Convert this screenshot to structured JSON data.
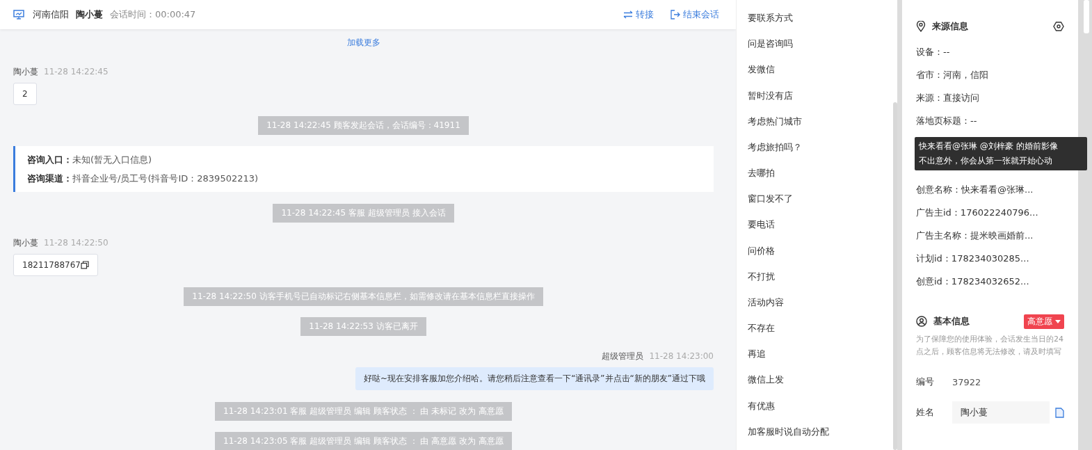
{
  "header": {
    "location": "河南信阳",
    "visitor": "陶小蔓",
    "duration_label": "会话时间：",
    "duration": "00:00:47",
    "actions": [
      {
        "kind": "transfer",
        "label": "转接"
      },
      {
        "kind": "end",
        "label": "结束会话"
      }
    ]
  },
  "messages": [
    {
      "kind": "load_more",
      "text": "加载更多"
    },
    {
      "kind": "customer",
      "name": "陶小蔓",
      "time": "11-28 14:22:45",
      "text": "2",
      "copy": false
    },
    {
      "kind": "system",
      "text": "11-28 14:22:45 顾客发起会话，会话编号：41911"
    },
    {
      "kind": "info_card",
      "lines": [
        {
          "label": "咨询入口：",
          "value": "未知(暂无入口信息)"
        },
        {
          "label": "咨询渠道：",
          "value": "抖音企业号/员工号(抖音号ID：2839502213)"
        }
      ]
    },
    {
      "kind": "system",
      "text": "11-28 14:22:45 客服 超级管理员 接入会话"
    },
    {
      "kind": "customer",
      "name": "陶小蔓",
      "time": "11-28 14:22:50",
      "text": "18211788767",
      "copy": true
    },
    {
      "kind": "system",
      "text": "11-28 14:22:50 访客手机号已自动标记右侧基本信息栏，如需修改请在基本信息栏直接操作"
    },
    {
      "kind": "system",
      "text": "11-28 14:22:53 访客已离开"
    },
    {
      "kind": "agent",
      "name": "超级管理员",
      "time": "11-28 14:23:00",
      "text": "好哒~现在安排客服加您介绍哈。请您稍后注意查看一下“通讯录”并点击“新的朋友”通过下哦"
    },
    {
      "kind": "system",
      "text": "11-28 14:23:01 客服 超级管理员 编辑 顾客状态 ： 由 未标记 改为 高意愿"
    },
    {
      "kind": "system",
      "text": "11-28 14:23:05 客服 超级管理员 编辑 顾客状态 ： 由 高意愿 改为 高意愿"
    }
  ],
  "quick_replies": [
    "要联系方式",
    "问是咨询吗",
    "发微信",
    "暂时没有店",
    "考虑热门城市",
    "考虑旅拍吗？",
    "去哪拍",
    "窗口发不了",
    "要电话",
    "问价格",
    "不打扰",
    "活动内容",
    "不存在",
    "再追",
    "微信上发",
    "有优惠",
    "加客服时说自动分配"
  ],
  "source_info": {
    "title": "来源信息",
    "rows": [
      {
        "kind": "field",
        "text": "设备：--"
      },
      {
        "kind": "field",
        "text": "省市：河南，信阳"
      },
      {
        "kind": "field",
        "text": "来源：直接访问"
      },
      {
        "kind": "field",
        "text": "落地页标题：--"
      },
      {
        "kind": "tooltip",
        "lines": [
          "快来看看@张琳 @刘梓豪 的婚前影像",
          "不出意外，你会从第一张就开始心动"
        ]
      },
      {
        "kind": "field",
        "text": "创意名称：快来看看@张琳..."
      },
      {
        "kind": "field",
        "text": "广告主id：176022240796..."
      },
      {
        "kind": "field",
        "text": "广告主名称：提米映画婚前..."
      },
      {
        "kind": "field",
        "text": "计划id：178234030285..."
      },
      {
        "kind": "field",
        "text": "创意id：178234032652..."
      }
    ]
  },
  "basic_info": {
    "title": "基本信息",
    "status": "高意愿",
    "note": "为了保障您的使用体验，会话发生当日的24点之后，顾客信息将无法修改，请及时填写",
    "fields": [
      {
        "kind": "text",
        "label": "编号",
        "value": "37922"
      },
      {
        "kind": "input",
        "label": "姓名",
        "value": "陶小蔓"
      }
    ]
  }
}
